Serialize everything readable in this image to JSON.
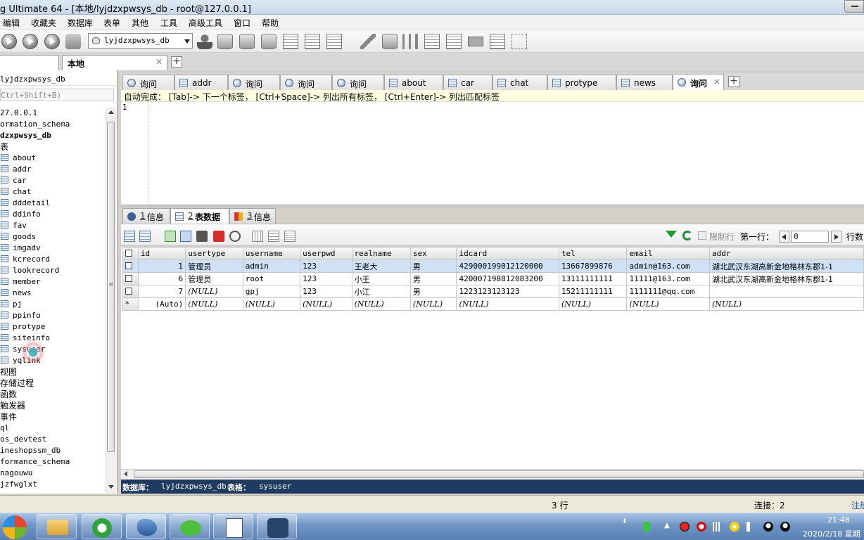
{
  "window": {
    "title": "g Ultimate 64 - [本地/lyjdzxpwsys_db - root@127.0.0.1]"
  },
  "menu": [
    "编辑",
    "收藏夹",
    "数据库",
    "表单",
    "其他",
    "工具",
    "高级工具",
    "窗口",
    "帮助"
  ],
  "toolbar": {
    "db_selected": "lyjdzxpwsys_db"
  },
  "connection_tab": {
    "label": "本地"
  },
  "left_panel": {
    "db_label": "lyjdzxpwsys_db",
    "filter_placeholder": "Ctrl+Shift+B)",
    "tree": [
      "27.0.0.1",
      "ormation_schema",
      "dzxpwsys_db",
      "表",
      "about",
      "addr",
      "car",
      "chat",
      "dddetail",
      "ddinfo",
      "fav",
      "goods",
      "imgadv",
      "kcrecord",
      "lookrecord",
      "member",
      "news",
      "pj",
      "ppinfo",
      "protype",
      "siteinfo",
      "sysuser",
      "yqlink",
      "视图",
      "存储过程",
      "函数",
      "触发器",
      "事件",
      "ql",
      "os_devtest",
      "ineshopssm_db",
      "formance_schema",
      "nagouwu",
      "jzfwglxt"
    ]
  },
  "query_tabs": [
    {
      "label": "询问",
      "icon": "query"
    },
    {
      "label": "addr",
      "icon": "table"
    },
    {
      "label": "询问",
      "icon": "query"
    },
    {
      "label": "询问",
      "icon": "query"
    },
    {
      "label": "询问",
      "icon": "query"
    },
    {
      "label": "about",
      "icon": "table"
    },
    {
      "label": "car",
      "icon": "table"
    },
    {
      "label": "chat",
      "icon": "table"
    },
    {
      "label": "protype",
      "icon": "table"
    },
    {
      "label": "news",
      "icon": "table"
    },
    {
      "label": "询问",
      "icon": "query",
      "active": true,
      "close": "×"
    }
  ],
  "editor": {
    "hint": "自动完成： [Tab]-> 下一个标签， [Ctrl+Space]-> 列出所有标签， [Ctrl+Enter]-> 列出匹配标签",
    "line_number": "1"
  },
  "result_tabs": [
    {
      "num": "1",
      "label": "信息"
    },
    {
      "num": "2",
      "label": "表数据",
      "active": true
    },
    {
      "num": "3",
      "label": "信息"
    }
  ],
  "result_toolbar": {
    "limit_label": "限制行",
    "first_row_label": "第一行：",
    "first_row_value": "0",
    "rows_label": "行数"
  },
  "grid": {
    "columns": [
      "id",
      "usertype",
      "username",
      "userpwd",
      "realname",
      "sex",
      "idcard",
      "tel",
      "email",
      "addr"
    ],
    "rows": [
      [
        "1",
        "管理员",
        "admin",
        "123",
        "王老大",
        "男",
        "429000199012120000",
        "13667899876",
        "admin@163.com",
        "湖北武汉东湖高新金地格林东郡1-1"
      ],
      [
        "6",
        "管理员",
        "root",
        "123",
        "小王",
        "男",
        "420007198812083200",
        "13111111111",
        "11111@163.com",
        "湖北武汉东湖高新金地格林东郡1-1"
      ],
      [
        "7",
        "(NULL)",
        "gpj",
        "123",
        "小江",
        "男",
        "1223123123123",
        "15211111111",
        "1111111@qq.com",
        ""
      ],
      [
        "(Auto)",
        "(NULL)",
        "(NULL)",
        "(NULL)",
        "(NULL)",
        "(NULL)",
        "(NULL)",
        "(NULL)",
        "(NULL)",
        "(NULL)"
      ]
    ],
    "new_row_marker": "*"
  },
  "info_bar": {
    "db_label": "数据库：",
    "db_value": "lyjdzxpwsys_db",
    "table_label": "表格：",
    "table_value": "sysuser"
  },
  "status_bar": {
    "rows": "3 行",
    "connection": "连接：2",
    "register": "注册"
  },
  "taskbar": {
    "time": "21:48",
    "date": "2020/2/18 星期"
  }
}
